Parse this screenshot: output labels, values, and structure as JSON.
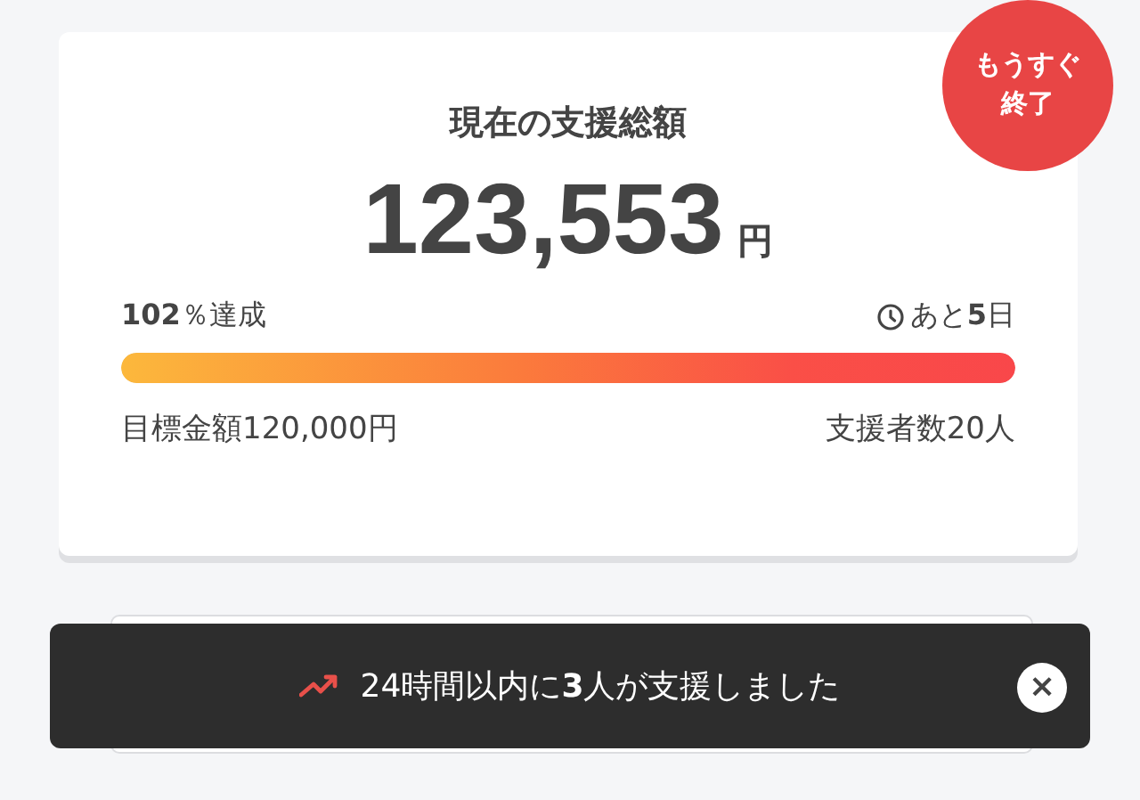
{
  "funding": {
    "title": "現在の支援総額",
    "amount": "123,553",
    "unit": "円",
    "badge": "もうすぐ終了",
    "achievement": "**102**％達成",
    "remaining": "あと**5**日",
    "level": 1,
    "goal": "目標金額120,000円",
    "supporters": "支援者数20人"
  },
  "toast": {
    "message": "24時間以内に**3**人が支援しました",
    "close": "×"
  }
}
